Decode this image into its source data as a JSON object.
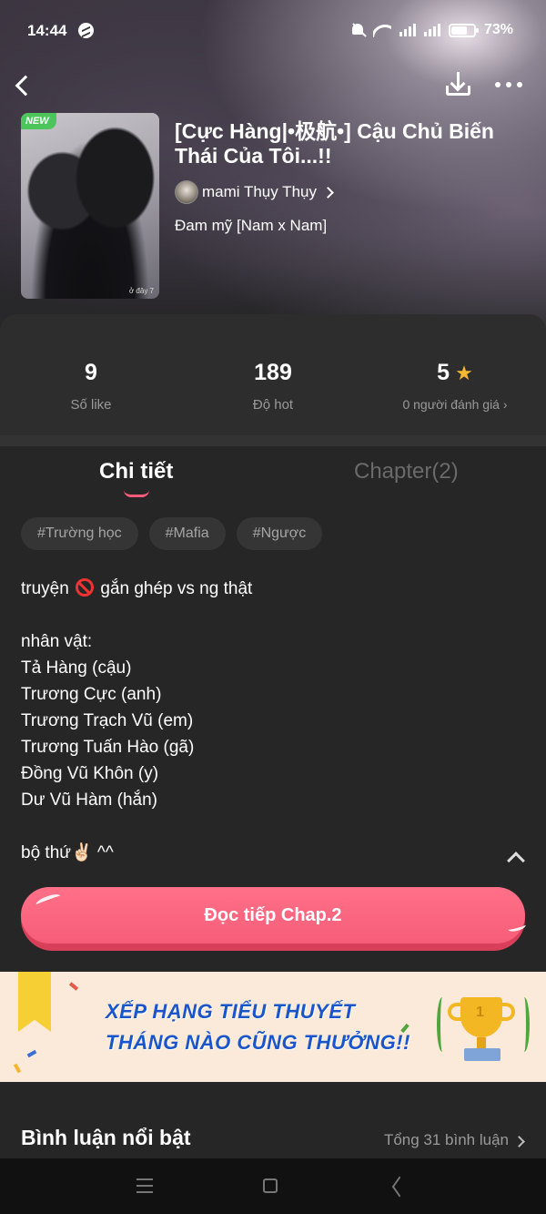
{
  "status_bar": {
    "time": "14:44",
    "battery": "73%",
    "battery_level": 0.73
  },
  "story": {
    "badge": "NEW",
    "cover_watermark": "ở đây 7",
    "title": "[Cực Hàng|•极航•] Cậu Chủ Biến Thái Của Tôi...!!",
    "author": "mami Thụy Thụy",
    "genre": "Đam mỹ [Nam x Nam]"
  },
  "stats": {
    "likes": {
      "value": "9",
      "label": "Số like"
    },
    "hot": {
      "value": "189",
      "label": "Độ hot"
    },
    "rating": {
      "value": "5",
      "label": "0 người đánh giá"
    }
  },
  "tabs": {
    "details": "Chi tiết",
    "chapters": "Chapter(2)"
  },
  "tags": [
    "#Trường học",
    "#Mafia",
    "#Ngược"
  ],
  "description": {
    "line1_before": "truyện",
    "line1_after": "gắn ghép vs ng thật",
    "characters_heading": "nhân vật:",
    "characters": [
      "Tả Hàng (cậu)",
      "Trương Cực (anh)",
      "Trương Trạch Vũ (em)",
      "Trương Tuấn Hào (gã)",
      "Đồng Vũ Khôn (y)",
      "Dư Vũ Hàm (hắn)"
    ],
    "last_line": "bộ thứ✌🏻 ^^"
  },
  "read_button": "Đọc tiếp Chap.2",
  "banner": {
    "line1": "XẾP HẠNG TIỂU THUYẾT",
    "line2": "THÁNG NÀO CŨNG THƯỞNG!!"
  },
  "comments": {
    "title": "Bình luận nổi bật",
    "total": "Tổng 31 bình luận"
  },
  "colors": {
    "accent": "#f65d78",
    "background": "#262626",
    "star": "#f5b82e",
    "new_badge": "#4cc55a",
    "banner_text": "#1a55c9"
  }
}
